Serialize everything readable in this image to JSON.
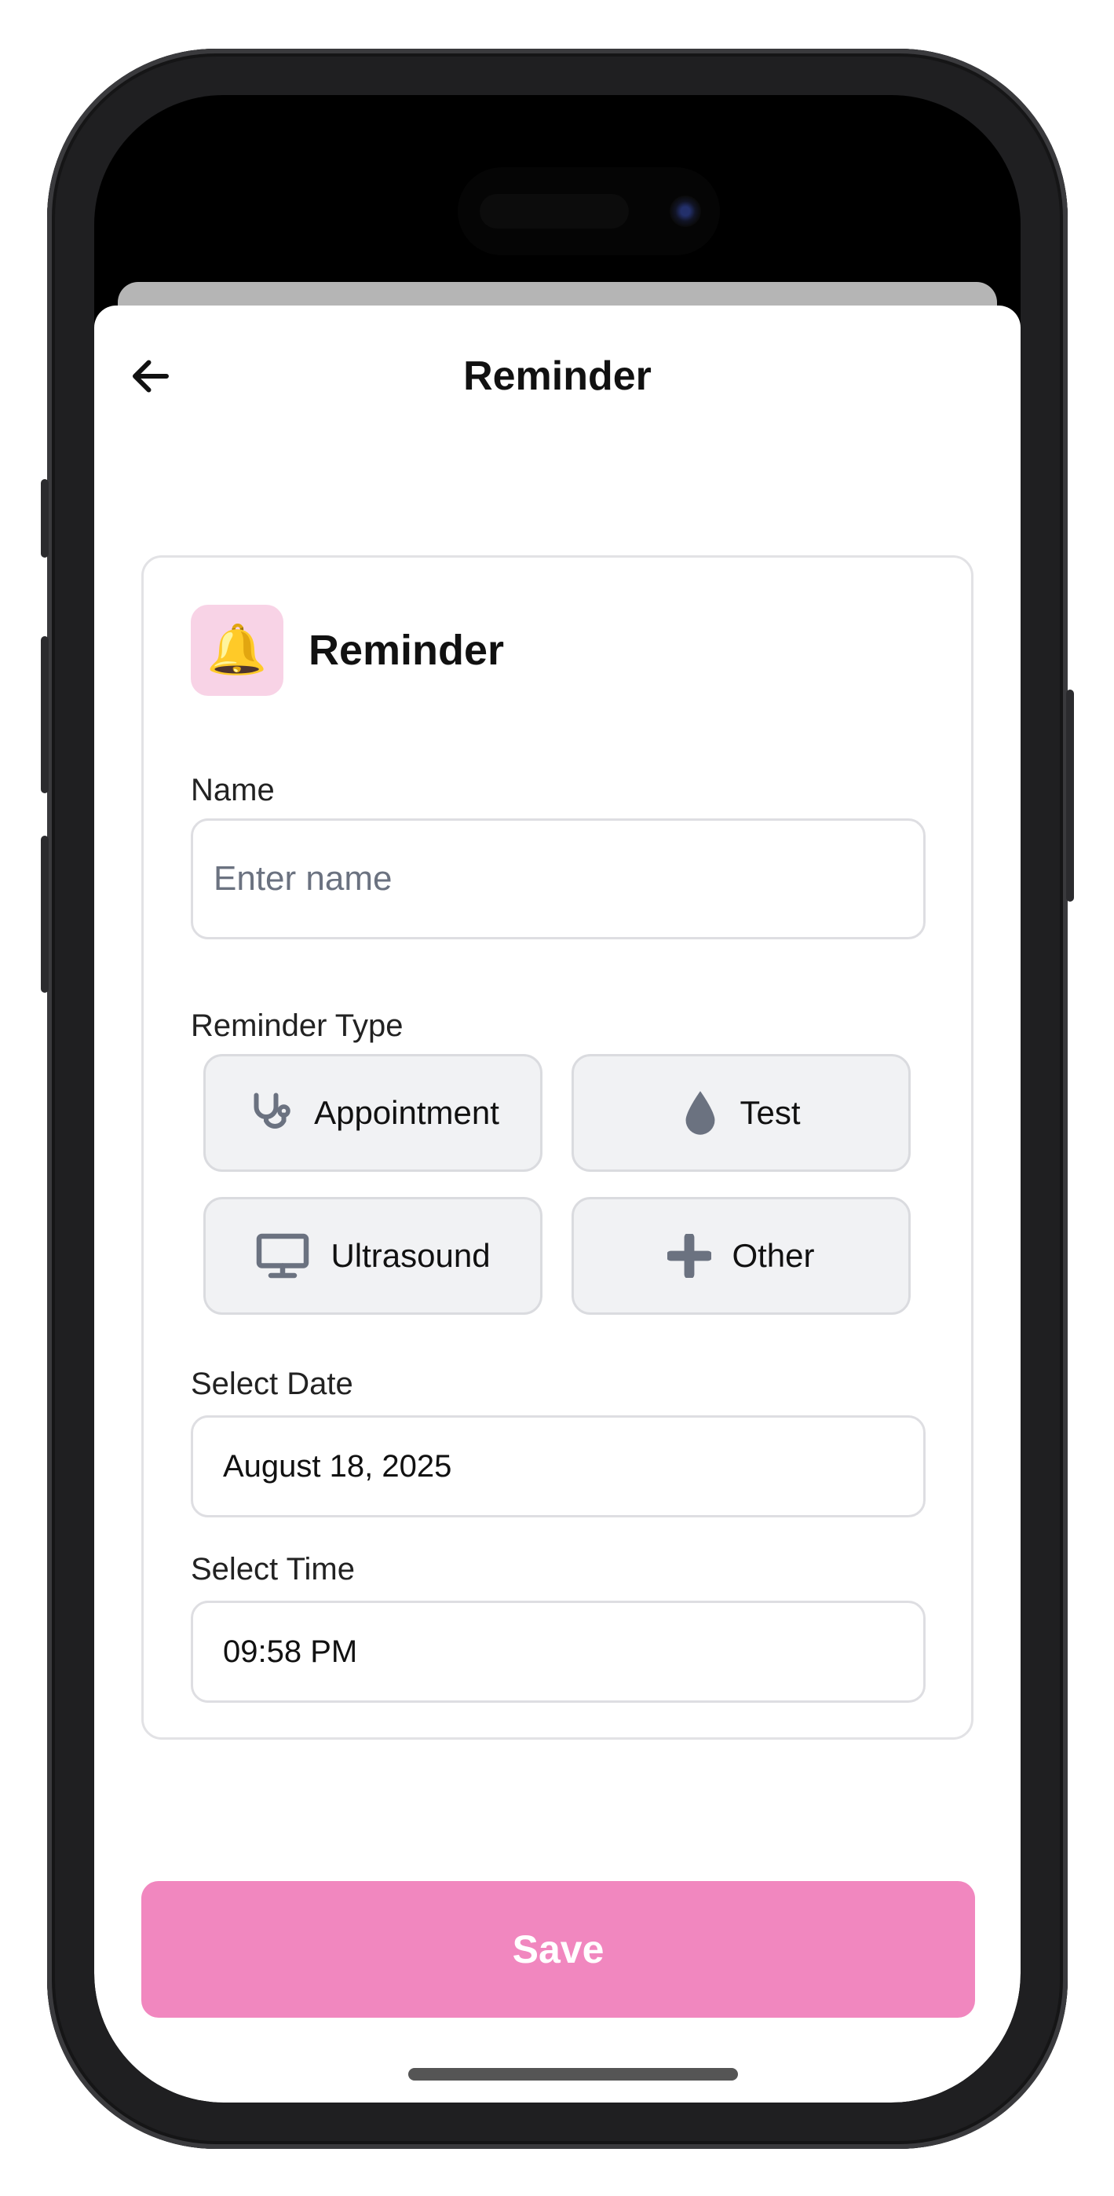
{
  "header": {
    "title": "Reminder"
  },
  "card": {
    "title": "Reminder",
    "icon_emoji": "🔔",
    "name": {
      "label": "Name",
      "placeholder": "Enter name",
      "value": ""
    },
    "reminder_type": {
      "label": "Reminder Type",
      "options": [
        {
          "label": "Appointment",
          "icon": "stethoscope-icon"
        },
        {
          "label": "Test",
          "icon": "drop-icon"
        },
        {
          "label": "Ultrasound",
          "icon": "monitor-icon"
        },
        {
          "label": "Other",
          "icon": "plus-icon"
        }
      ]
    },
    "date": {
      "label": "Select Date",
      "value": "August 18, 2025"
    },
    "time": {
      "label": "Select Time",
      "value": "09:58 PM"
    }
  },
  "save": {
    "label": "Save"
  },
  "colors": {
    "accent": "#f187bf",
    "icon_bg": "#f8d3e6",
    "icon_grey": "#6b7280"
  }
}
